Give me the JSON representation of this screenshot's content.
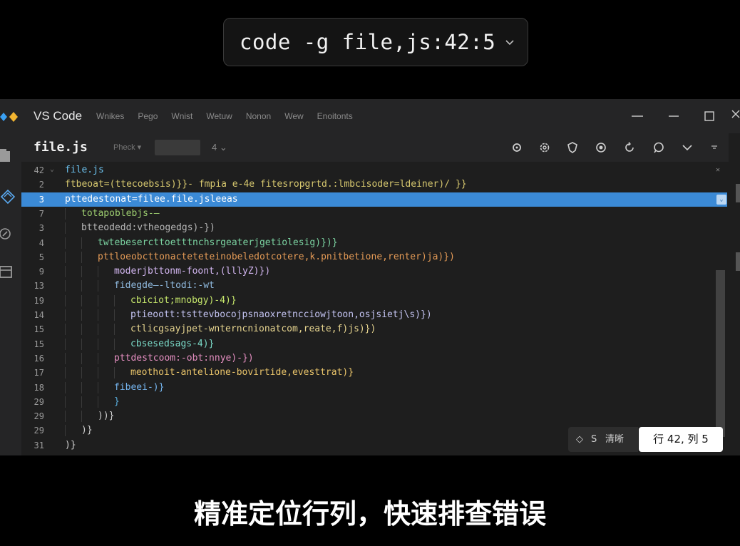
{
  "command": {
    "text": "code -g file,js:42:5"
  },
  "window": {
    "app_name": "VS Code",
    "menu": [
      "Wnikes",
      "Pego",
      "Wnist",
      "Wetuw",
      "Nonon",
      "Wew",
      "Enoitonts"
    ]
  },
  "tab": {
    "title": "file.js",
    "meta": "Pheck ▾",
    "count": "4 ⌄"
  },
  "status": {
    "icon_label": "S",
    "label": "清晰",
    "position": "行 42, 列 5"
  },
  "code_lines": [
    {
      "num": "42",
      "indent": 0,
      "text": "file.js",
      "color": "#6cc3f0"
    },
    {
      "num": "2",
      "indent": 0,
      "text": "ftbeoat=(ttecoebsis)}}- fmpia e-4e fitesropgrtd.:lmbcisoder=ldeiner)/ }}",
      "color": "#d7c86f"
    },
    {
      "num": "3",
      "indent": 0,
      "text": "pttedestonat=filee.file.jsleeas",
      "color": "#ffffff",
      "highlight": true
    },
    {
      "num": "7",
      "indent": 1,
      "text": "totapoblebjs-—",
      "color": "#9ccc6f"
    },
    {
      "num": "3",
      "indent": 1,
      "text": "btteodedd:vtheogedgs)-})",
      "color": "#b8b8b8"
    },
    {
      "num": "4",
      "indent": 2,
      "text": "twtebesercttoetttnchsrgeaterjgetiolesig)})}",
      "color": "#7bd3a1"
    },
    {
      "num": "5",
      "indent": 2,
      "text": "pttloeobcttonacteteteinobeledotcotere,k.pnitbetione,renter)ja)})",
      "color": "#e39a56"
    },
    {
      "num": "9",
      "indent": 3,
      "text": "moderjbttonm-foont,(lllyZ)})",
      "color": "#d2b6f0"
    },
    {
      "num": "13",
      "indent": 3,
      "text": "fidegde—-ltodi:-wt",
      "color": "#8fb9de"
    },
    {
      "num": "19",
      "indent": 4,
      "text": "cbiciot;mnobgy)-4)}",
      "color": "#c5e66b"
    },
    {
      "num": "14",
      "indent": 4,
      "text": "ptieoott:tsttevbocojpsnaoxretncciowjtoon,osjsietj\\s)})",
      "color": "#c4c4f2"
    },
    {
      "num": "15",
      "indent": 4,
      "text": "ctlicgsayjpet-wnterncnionatcom,reate,f)js)})",
      "color": "#e6d48f"
    },
    {
      "num": "15",
      "indent": 4,
      "text": "cbsesedsags-4)}",
      "color": "#7ad9c7"
    },
    {
      "num": "16",
      "indent": 3,
      "text": "pttdestcoom:-obt:nnye)-})",
      "color": "#e48ec0"
    },
    {
      "num": "17",
      "indent": 4,
      "text": "meothoit-antelione-bovirtide,evesttrat)}",
      "color": "#e9c46a"
    },
    {
      "num": "18",
      "indent": 3,
      "text": "fibeei-)}",
      "color": "#74b4ee"
    },
    {
      "num": "29",
      "indent": 3,
      "text": "}",
      "color": "#5ab0e0"
    },
    {
      "num": "29",
      "indent": 2,
      "text": "))}",
      "color": "#cfcfcf"
    },
    {
      "num": "29",
      "indent": 1,
      "text": ")}",
      "color": "#cfcfcf"
    },
    {
      "num": "31",
      "indent": 0,
      "text": ")}",
      "color": "#cfcfcf"
    }
  ],
  "caption": "精准定位行列，快速排查错误"
}
